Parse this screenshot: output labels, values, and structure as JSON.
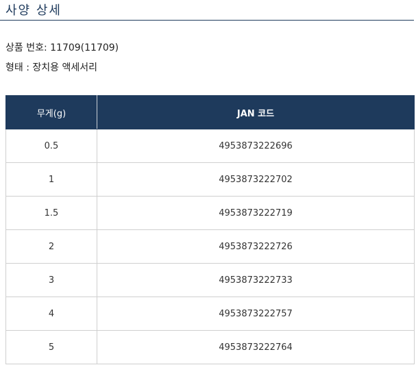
{
  "section": {
    "title": "사양 상세"
  },
  "info": {
    "product_number": "상품 번호: 11709(11709)",
    "form": "형태 : 장치용 액세서리"
  },
  "table": {
    "headers": [
      "무게(g)",
      "JAN 코드"
    ],
    "rows": [
      {
        "weight": "0.5",
        "jan": "4953873222696"
      },
      {
        "weight": "1",
        "jan": "4953873222702"
      },
      {
        "weight": "1.5",
        "jan": "4953873222719"
      },
      {
        "weight": "2",
        "jan": "4953873222726"
      },
      {
        "weight": "3",
        "jan": "4953873222733"
      },
      {
        "weight": "4",
        "jan": "4953873222757"
      },
      {
        "weight": "5",
        "jan": "4953873222764"
      }
    ]
  },
  "colors": {
    "accent": "#1e3a5c",
    "header_text": "#ffffff",
    "border": "#cfcfcf"
  }
}
